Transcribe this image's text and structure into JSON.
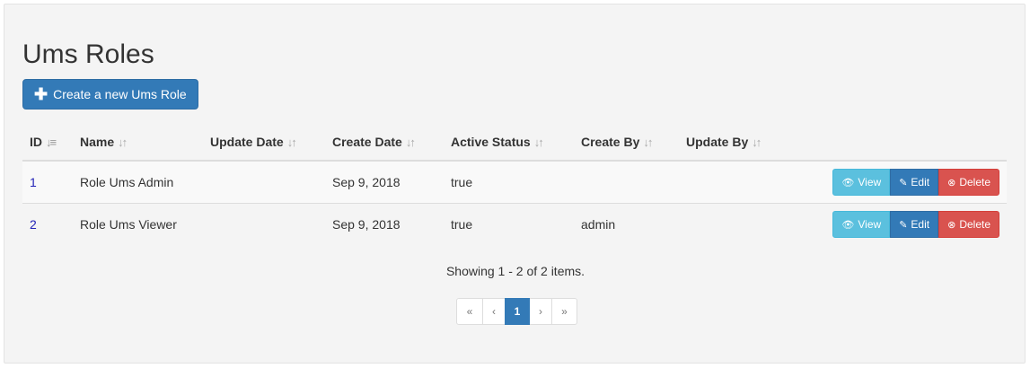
{
  "page": {
    "title": "Ums Roles",
    "create_button_label": "Create a new Ums Role"
  },
  "table": {
    "headers": [
      {
        "label": "ID",
        "sort_icon": "sort-numeric-icon",
        "sort_glyph": "↓≡"
      },
      {
        "label": "Name",
        "sort_icon": "sort-icon",
        "sort_glyph": "↓↑"
      },
      {
        "label": "Update Date",
        "sort_icon": "sort-icon",
        "sort_glyph": "↓↑"
      },
      {
        "label": "Create Date",
        "sort_icon": "sort-icon",
        "sort_glyph": "↓↑"
      },
      {
        "label": "Active Status",
        "sort_icon": "sort-icon",
        "sort_glyph": "↓↑"
      },
      {
        "label": "Create By",
        "sort_icon": "sort-icon",
        "sort_glyph": "↓↑"
      },
      {
        "label": "Update By",
        "sort_icon": "sort-icon",
        "sort_glyph": "↓↑"
      }
    ],
    "rows": [
      {
        "id": "1",
        "name": "Role Ums Admin",
        "update_date": "",
        "create_date": "Sep 9, 2018",
        "active_status": "true",
        "create_by": "",
        "update_by": ""
      },
      {
        "id": "2",
        "name": "Role Ums Viewer",
        "update_date": "",
        "create_date": "Sep 9, 2018",
        "active_status": "true",
        "create_by": "admin",
        "update_by": ""
      }
    ],
    "actions": {
      "view_label": "View",
      "edit_label": "Edit",
      "delete_label": "Delete"
    }
  },
  "summary": "Showing 1 - 2 of 2 items.",
  "pagination": {
    "first": "«",
    "prev": "‹",
    "current_page": "1",
    "next": "›",
    "last": "»"
  },
  "colors": {
    "primary": "#337ab7",
    "info": "#5bc0de",
    "danger": "#d9534f",
    "link": "#2323b7"
  },
  "icons": {
    "create": "plus-icon",
    "view": "eye-icon",
    "edit": "pencil-icon",
    "delete": "circle-x-icon"
  }
}
